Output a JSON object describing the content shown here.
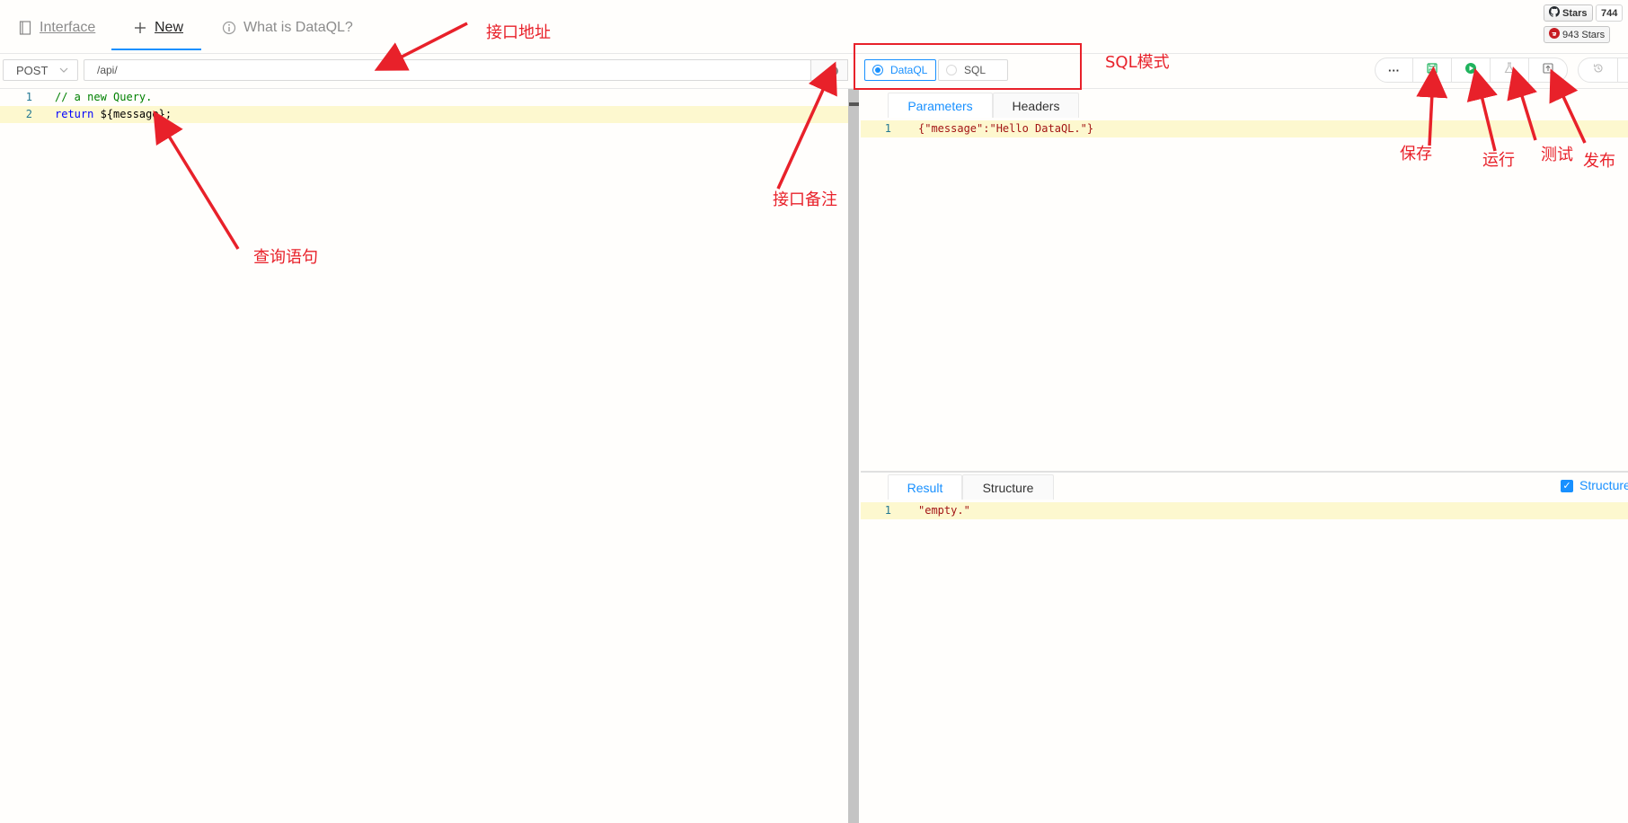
{
  "nav": {
    "tabs": [
      {
        "label": "Interface",
        "icon": "book-icon"
      },
      {
        "label": "New",
        "icon": "plus-icon"
      },
      {
        "label": "What is DataQL?",
        "icon": "info-circle-icon"
      }
    ]
  },
  "github": {
    "stars_label": "Stars",
    "stars_count": "744",
    "gitee_label": "943 Stars"
  },
  "toolbar": {
    "method": "POST",
    "url": "/api/",
    "mode_options": [
      "DataQL",
      "SQL"
    ],
    "selected_mode": "DataQL",
    "more_label": "···"
  },
  "editor": {
    "lines": [
      {
        "num": "1",
        "text": "// a new Query."
      },
      {
        "num": "2",
        "keyword": "return",
        "text": " ${message};"
      }
    ]
  },
  "params_panel": {
    "tabs": [
      "Parameters",
      "Headers"
    ],
    "lines": [
      {
        "num": "1",
        "text": "{\"message\":\"Hello DataQL.\"}"
      }
    ]
  },
  "result_panel": {
    "tabs": [
      "Result",
      "Structure"
    ],
    "structure_toggle_label": "Structure",
    "lines": [
      {
        "num": "1",
        "text": "\"empty.\""
      }
    ]
  },
  "annotations": {
    "api_address": "接口地址",
    "sql_mode": "SQL模式",
    "api_comment": "接口备注",
    "query_statement": "查询语句",
    "save": "保存",
    "run": "运行",
    "test": "测试",
    "publish": "发布"
  },
  "colors": {
    "accent": "#1890ff",
    "annotation": "#e8212a",
    "run_green": "#1fb35d",
    "line_highlight": "#fdf8cf"
  }
}
